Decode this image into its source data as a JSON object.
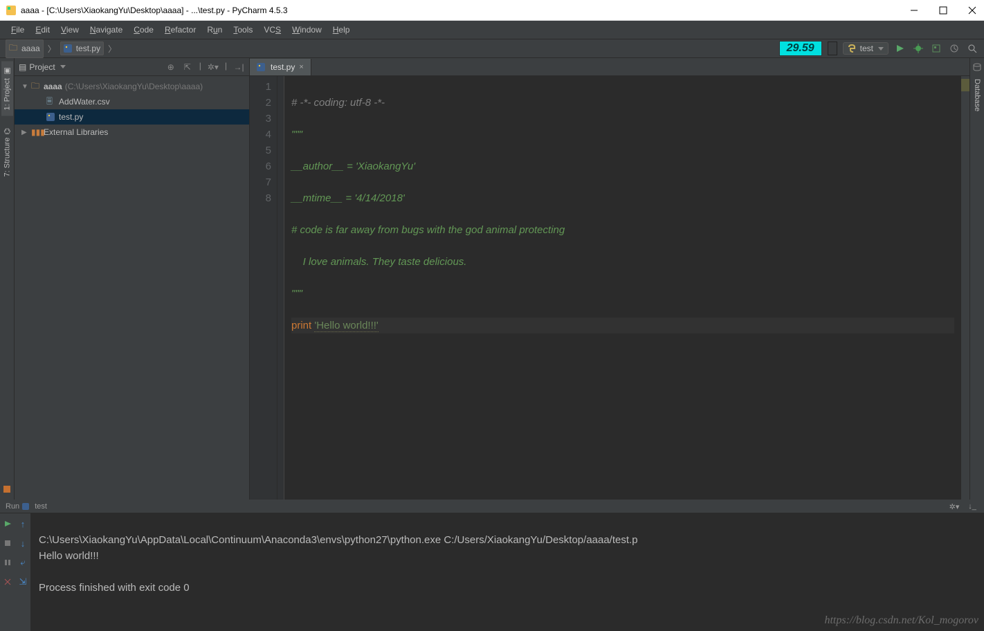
{
  "window": {
    "title": "aaaa - [C:\\Users\\XiaokangYu\\Desktop\\aaaa] - ...\\test.py - PyCharm 4.5.3"
  },
  "menubar": [
    "File",
    "Edit",
    "View",
    "Navigate",
    "Code",
    "Refactor",
    "Run",
    "Tools",
    "VCS",
    "Window",
    "Help"
  ],
  "breadcrumb": {
    "project": "aaaa",
    "file": "test.py"
  },
  "nav_right": {
    "timer": "29.59",
    "config": "test"
  },
  "project": {
    "panel_title": "Project",
    "root": {
      "name": "aaaa",
      "path": "(C:\\Users\\XiaokangYu\\Desktop\\aaaa)"
    },
    "files": [
      "AddWater.csv",
      "test.py"
    ],
    "ext_lib": "External Libraries"
  },
  "left_tabs": {
    "project": "1: Project",
    "structure": "7: Structure"
  },
  "right_tabs": {
    "database": "Database"
  },
  "editor_tab": "test.py",
  "code": {
    "lines": [
      "1",
      "2",
      "3",
      "4",
      "5",
      "6",
      "7",
      "8"
    ],
    "l1": "# -*- coding: utf-8 -*-",
    "l2": "\"\"\"",
    "l3a": "__author__",
    "l3b": " = ",
    "l3c": "'XiaokangYu'",
    "l4a": "__mtime__",
    "l4b": " = ",
    "l4c": "'4/14/2018'",
    "l5": "# code is far away from bugs with the god animal protecting",
    "l6": "    I love animals. They taste delicious.",
    "l7": "\"\"\"",
    "l8a": "print",
    "l8b": " ",
    "l8c": "'Hello world!!!'"
  },
  "run": {
    "title": "Run",
    "name": "test",
    "line1": "C:\\Users\\XiaokangYu\\AppData\\Local\\Continuum\\Anaconda3\\envs\\python27\\python.exe C:/Users/XiaokangYu/Desktop/aaaa/test.p",
    "line2": "Hello world!!!",
    "line3": "",
    "line4": "Process finished with exit code 0"
  },
  "watermark": "https://blog.csdn.net/Kol_mogorov"
}
